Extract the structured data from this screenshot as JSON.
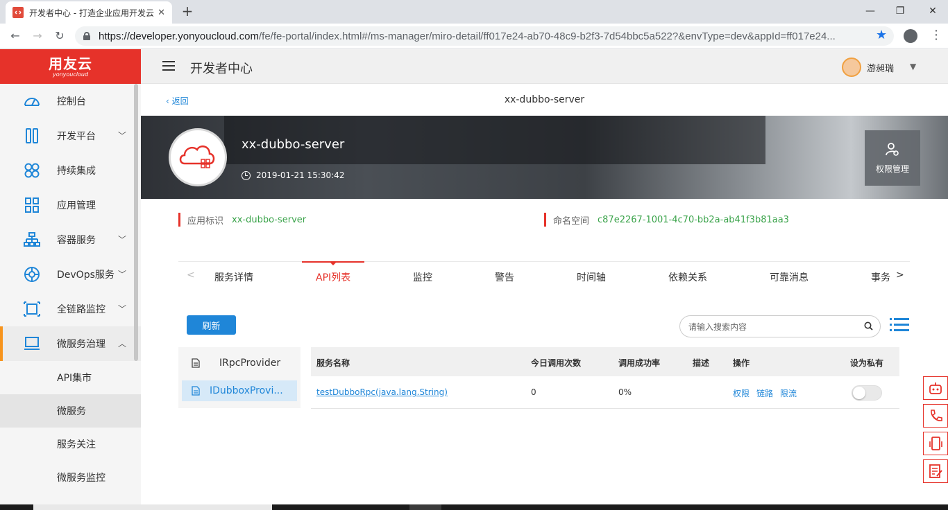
{
  "browser": {
    "tab_title": "开发者中心 - 打造企业应用开发云",
    "url_host": "https://developer.yonyoucloud.com",
    "url_path": "/fe/fe-portal/index.html#/ms-manager/miro-detail/ff017e24-ab70-48c9-b2f3-7d54bbc5a522?&envType=dev&appId=ff017e24..."
  },
  "logo": {
    "main": "用友云",
    "sub": "yonyoucloud"
  },
  "sidebar": {
    "items": [
      {
        "label": "控制台",
        "icon": "dashboard-icon",
        "chevron": ""
      },
      {
        "label": "开发平台",
        "icon": "dev-platform-icon",
        "chevron": "﹀"
      },
      {
        "label": "持续集成",
        "icon": "ci-icon",
        "chevron": ""
      },
      {
        "label": "应用管理",
        "icon": "app-grid-icon",
        "chevron": ""
      },
      {
        "label": "容器服务",
        "icon": "container-icon",
        "chevron": "﹀"
      },
      {
        "label": "DevOps服务",
        "icon": "devops-icon",
        "chevron": "﹀"
      },
      {
        "label": "全链路监控",
        "icon": "monitor-icon",
        "chevron": "﹀"
      },
      {
        "label": "微服务治理",
        "icon": "laptop-icon",
        "chevron": "︿"
      }
    ],
    "subitems": [
      "API集市",
      "微服务",
      "服务关注",
      "微服务监控"
    ]
  },
  "header": {
    "title": "开发者中心",
    "username": "游昶瑞"
  },
  "main": {
    "back_label": "返回",
    "page_title": "xx-dubbo-server",
    "banner": {
      "app_name": "xx-dubbo-server",
      "created_time": "2019-01-21 15:30:42",
      "perm_label": "权限管理"
    },
    "info": {
      "app_id_label": "应用标识",
      "app_id_value": "xx-dubbo-server",
      "namespace_label": "命名空间",
      "namespace_value": "c87e2267-1001-4c70-bb2a-ab41f3b81aa3"
    },
    "tabs": [
      "服务详情",
      "API列表",
      "监控",
      "警告",
      "时间轴",
      "依赖关系",
      "可靠消息",
      "事务"
    ],
    "tab_arrows": {
      "left": "<",
      "right": ">"
    },
    "refresh_label": "刷新",
    "search_placeholder": "请输入搜索内容",
    "providers": [
      "IRpcProvider",
      "IDubboxProvi..."
    ],
    "table": {
      "headers": [
        "服务名称",
        "今日调用次数",
        "调用成功率",
        "描述",
        "操作",
        "设为私有"
      ],
      "rows": [
        {
          "name": "testDubboRpc(java.lang.String)",
          "calls": "0",
          "success_rate": "0%",
          "desc": "",
          "ops": [
            "权限",
            "链路",
            "限流"
          ],
          "private": false
        }
      ]
    }
  },
  "colors": {
    "brand_red": "#e6322a",
    "accent_blue": "#1f86d8",
    "value_green": "#3aa34a",
    "active_bar": "#f7941d"
  }
}
